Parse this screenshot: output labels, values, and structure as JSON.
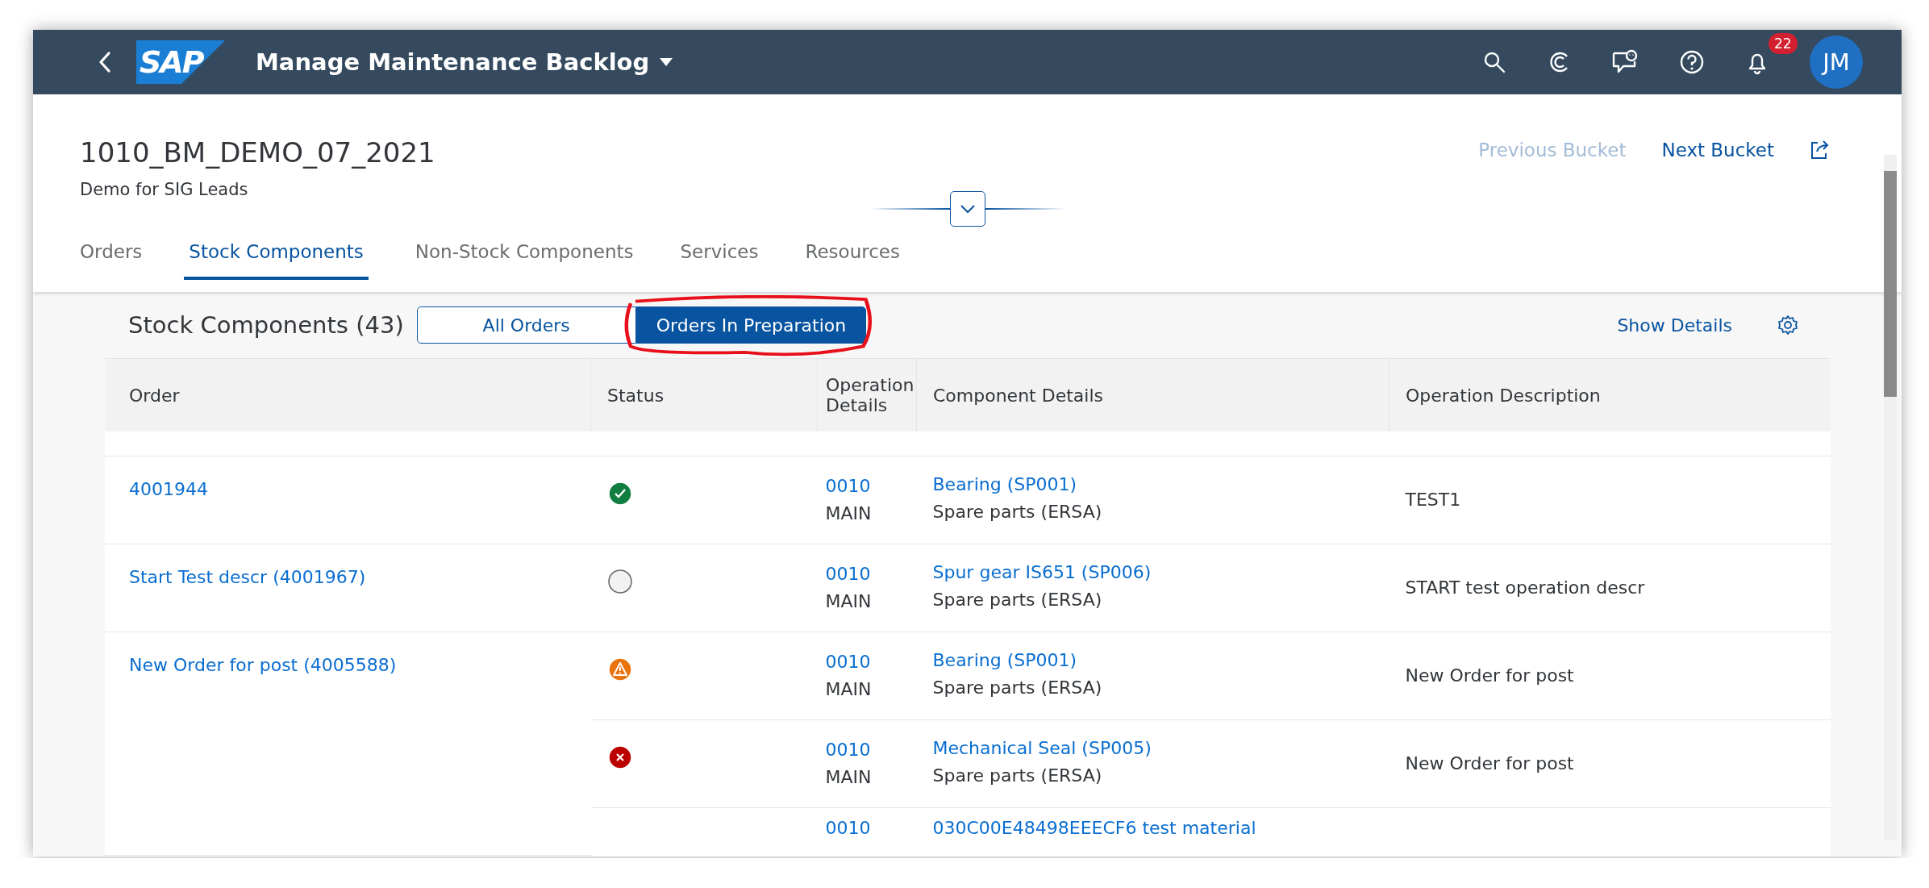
{
  "shell": {
    "logo_text": "SAP",
    "title": "Manage Maintenance Backlog",
    "notification_count": "22",
    "avatar_initials": "JM"
  },
  "header": {
    "title": "1010_BM_DEMO_07_2021",
    "subtitle": "Demo for SIG Leads",
    "actions": [
      {
        "label": "Previous Bucket",
        "disabled": true
      },
      {
        "label": "Next Bucket",
        "disabled": false
      }
    ]
  },
  "tabs": [
    {
      "label": "Orders",
      "selected": false
    },
    {
      "label": "Stock Components",
      "selected": true
    },
    {
      "label": "Non-Stock Components",
      "selected": false
    },
    {
      "label": "Services",
      "selected": false
    },
    {
      "label": "Resources",
      "selected": false
    }
  ],
  "toolbar": {
    "title": "Stock Components (43)",
    "segments": [
      {
        "label": "All Orders",
        "selected": false,
        "highlighted": false
      },
      {
        "label": "Orders In Preparation",
        "selected": true,
        "highlighted": true
      }
    ],
    "show_details": "Show Details"
  },
  "table": {
    "columns": [
      "Order",
      "Status",
      "Operation Details",
      "Component Details",
      "Operation Description"
    ],
    "rows": [
      {
        "order": "4001944",
        "items": [
          {
            "kind": "success",
            "operation": "0010",
            "work_center": "MAIN",
            "component": "Bearing (SP001)",
            "component_type": "Spare parts (ERSA)",
            "description": "TEST1"
          }
        ]
      },
      {
        "order": "Start Test descr (4001967)",
        "items": [
          {
            "kind": "none",
            "operation": "0010",
            "work_center": "MAIN",
            "component": "Spur gear IS651 (SP006)",
            "component_type": "Spare parts (ERSA)",
            "description": "START test operation descr"
          }
        ]
      },
      {
        "order": "New Order for post (4005588)",
        "items": [
          {
            "kind": "warning",
            "operation": "0010",
            "work_center": "MAIN",
            "component": "Bearing (SP001)",
            "component_type": "Spare parts (ERSA)",
            "description": "New Order for post"
          },
          {
            "kind": "error",
            "operation": "0010",
            "work_center": "MAIN",
            "component": "Mechanical Seal (SP005)",
            "component_type": "Spare parts (ERSA)",
            "description": "New Order for post"
          },
          {
            "operation": "0010",
            "component": "030C00E48498EEECF6 test material"
          }
        ]
      }
    ]
  }
}
